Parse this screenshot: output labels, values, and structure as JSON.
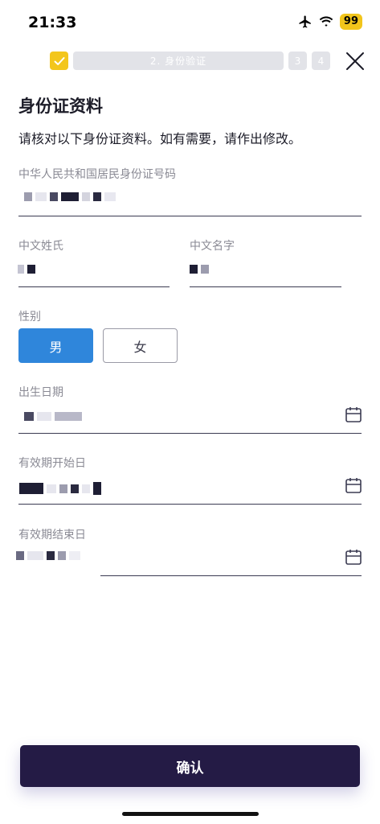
{
  "status_bar": {
    "time": "21:33",
    "battery": "99",
    "icons": [
      "airplane-icon",
      "wifi-icon",
      "battery-icon"
    ]
  },
  "progress": {
    "current_step_label": "2. 身份验证",
    "step3": "3",
    "step4": "4"
  },
  "page": {
    "title": "身份证资料",
    "subtitle": "请核对以下身份证资料。如有需要，请作出修改。"
  },
  "form": {
    "id_number_label": "中华人民共和国居民身份证号码",
    "surname_label": "中文姓氏",
    "given_name_label": "中文名字",
    "gender_label": "性别",
    "gender_male": "男",
    "gender_female": "女",
    "gender_selected": "男",
    "birth_date_label": "出生日期",
    "valid_from_label": "有效期开始日",
    "valid_to_label": "有效期结束日"
  },
  "actions": {
    "confirm_label": "确认"
  },
  "colors": {
    "accent_blue": "#2f86db",
    "primary_dark": "#241b45",
    "step_done_yellow": "#f3c61c",
    "step_inactive": "#e2e3e8"
  }
}
